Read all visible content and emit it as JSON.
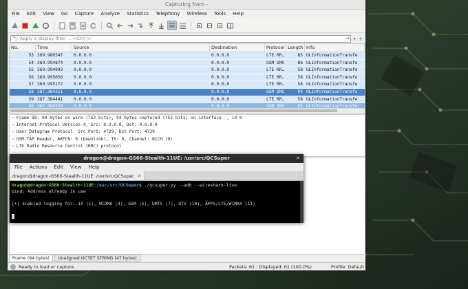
{
  "wireshark": {
    "title": "Capturing from -",
    "menu": [
      "File",
      "Edit",
      "View",
      "Go",
      "Capture",
      "Analyze",
      "Statistics",
      "Telephony",
      "Wireless",
      "Tools",
      "Help"
    ],
    "filter": {
      "placeholder": "Apply a display filter ... <Ctrl-/>"
    },
    "columns": [
      "No.",
      "Time",
      "Source",
      "Destination",
      "Protocol",
      "Length",
      "Info"
    ],
    "packets": [
      {
        "no": "53",
        "time": "369.986547",
        "src": "0.0.0.0",
        "dst": "0.0.0.0",
        "proto": "LTE RR…",
        "len": "85",
        "info": "ULInformationTransfe"
      },
      {
        "no": "54",
        "time": "369.994874",
        "src": "0.0.0.0",
        "dst": "0.0.0.0",
        "proto": "GSM SMS",
        "len": "86",
        "info": "ULInformationTransfe"
      },
      {
        "no": "55",
        "time": "369.994993",
        "src": "0.0.0.0",
        "dst": "0.0.0.0",
        "proto": "LTE RR…",
        "len": "58",
        "info": "ULInformationTransfe"
      },
      {
        "no": "56",
        "time": "369.995056",
        "src": "0.0.0.0",
        "dst": "0.0.0.0",
        "proto": "LTE RR…",
        "len": "58",
        "info": "ULInformationTransfe"
      },
      {
        "no": "57",
        "time": "369.995172",
        "src": "0.0.0.0",
        "dst": "0.0.0.0",
        "proto": "LTE RR…",
        "len": "58",
        "info": "ULInformationTransfe"
      },
      {
        "no": "58",
        "time": "387.384211",
        "src": "0.0.0.0",
        "dst": "0.0.0.0",
        "proto": "GSM SMS",
        "len": "94",
        "info": "ULInformationTransfe"
      },
      {
        "no": "59",
        "time": "387.384441",
        "src": "0.0.0.0",
        "dst": "0.0.0.0",
        "proto": "LTE RR…",
        "len": "58",
        "info": "ULInformationTransfe"
      },
      {
        "no": "60",
        "time": "387.384529",
        "src": "0.0.0.0",
        "dst": "0.0.0.0",
        "proto": "GSM SMS",
        "len": "65",
        "info": "ULInformationTransfe"
      }
    ],
    "details": [
      "Frame 58: 94 bytes on wire (752 bits), 94 bytes captured (752 bits) on interface -, id 0",
      "Internet Protocol Version 4, Src: 0.0.0.0, Dst: 0.0.0.0",
      "User Datagram Protocol, Src Port: 4729, Dst Port: 4729",
      "GSM TAP Header, ARFCN: 0 (Downlink), TS: 0, Channel: BCCH (0)",
      "LTE Radio Resource Control (RRC) protocol"
    ],
    "bytes_tabs": [
      "Frame (94 bytes)",
      "Unaligned OCTET STRING (47 bytes)"
    ],
    "status": {
      "text": "Ready to load or capture",
      "packets": "Packets: 61 · Displayed: 61 (100.0%)",
      "profile": "Profile: Default"
    }
  },
  "terminal": {
    "title": "dragon@dragon-GS66-Stealth-11UE: /usr/src/QCSuper",
    "menu": [
      "File",
      "Actions",
      "Edit",
      "View",
      "Help"
    ],
    "tab_label": "dragon@dragon-GS66-Stealth-11UE: /usr/src/QCSuper",
    "prompt_user": "dragon@dragon-GS66-Stealth-11UE",
    "prompt_path": "/usr/src/QCSuper",
    "command": "$ ./qcsuper.py --adb --wireshark-live",
    "output": [
      "bind: Address already in use",
      "",
      "[+] Enabled logging for: 1X (1), WCDMA (4), GSM (5), UMTS (7), DTV (10), APPS/LTE/WIMAX (11)"
    ]
  }
}
